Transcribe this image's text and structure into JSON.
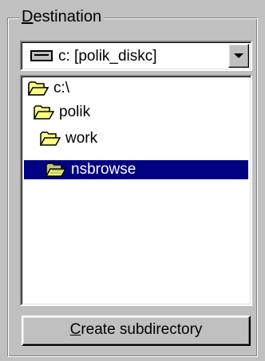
{
  "group": {
    "label_hotkey": "D",
    "label_rest": "estination"
  },
  "drive_combo": {
    "value": "c: [polik_diskc]",
    "icon": "drive-icon"
  },
  "tree": {
    "items": [
      {
        "label": "c:\\",
        "icon": "folder-open-icon",
        "depth": 0
      },
      {
        "label": "polik",
        "icon": "folder-open-icon",
        "depth": 1
      },
      {
        "label": "work",
        "icon": "folder-open-icon",
        "depth": 2
      },
      {
        "label": "nsbrowse",
        "icon": "folder-open-icon",
        "depth": 3,
        "selected": true
      }
    ],
    "selection_color": "#000080"
  },
  "create_button": {
    "label_hotkey": "C",
    "label_rest": "reate subdirectory"
  }
}
